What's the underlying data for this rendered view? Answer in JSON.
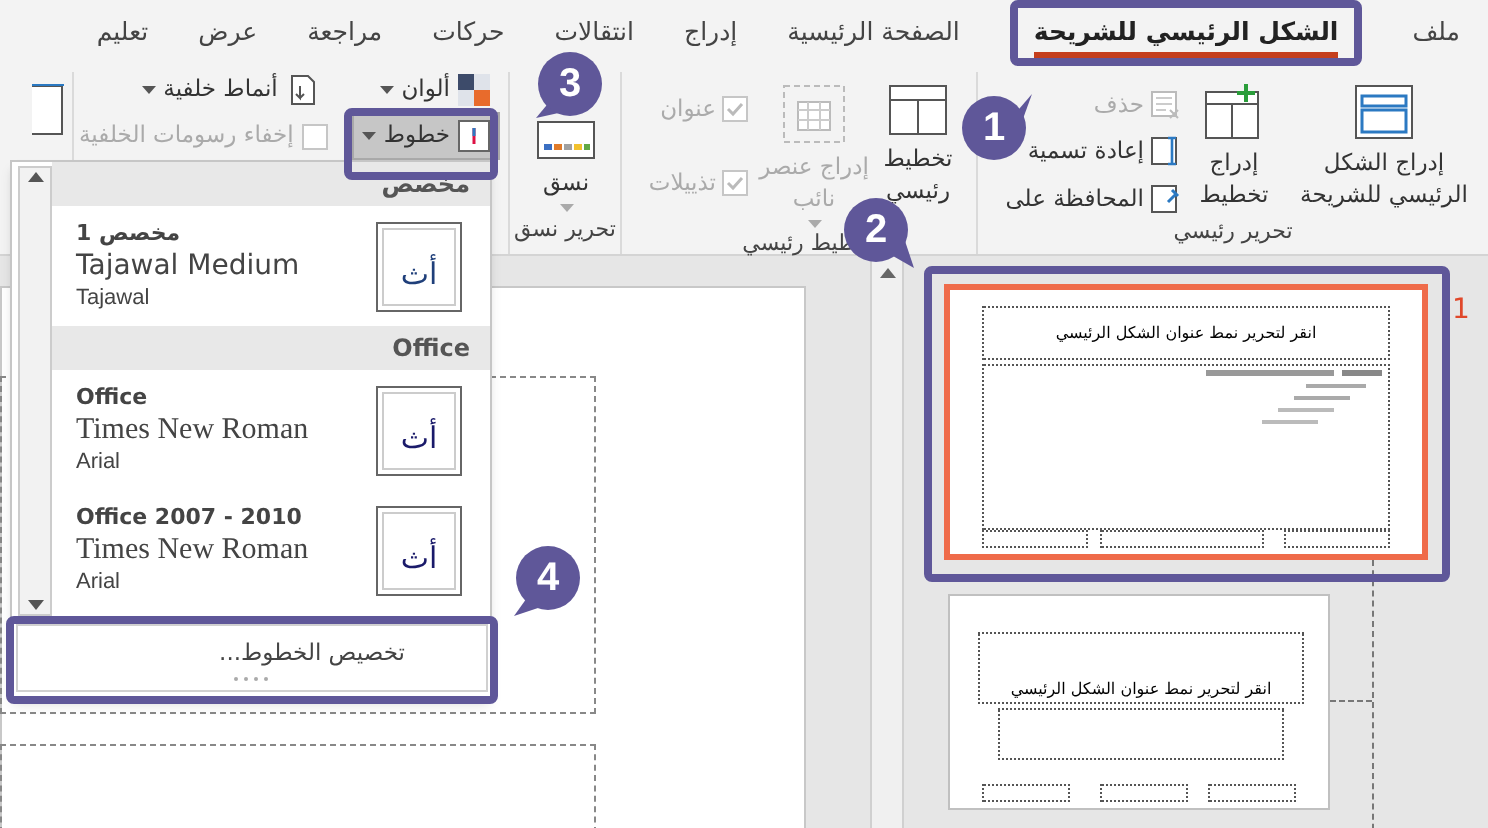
{
  "tabs": [
    {
      "label": "ملف",
      "selected": false
    },
    {
      "label": "الشكل الرئيسي للشريحة",
      "selected": true
    },
    {
      "label": "الصفحة الرئيسية",
      "selected": false
    },
    {
      "label": "إدراج",
      "selected": false
    },
    {
      "label": "انتقالات",
      "selected": false
    },
    {
      "label": "حركات",
      "selected": false
    },
    {
      "label": "مراجعة",
      "selected": false
    },
    {
      "label": "عرض",
      "selected": false
    },
    {
      "label": "تعليم",
      "selected": false
    }
  ],
  "master_edit": {
    "label": "تحرير رئيسي",
    "insert_master": "إدراج الشكل الرئيسي للشريحة",
    "insert_layout": "إدراج تخطيط",
    "small_buttons": [
      {
        "label": "حذف",
        "disabled": true
      },
      {
        "label": "إعادة تسمية",
        "disabled": false
      },
      {
        "label": "المحافظة على",
        "disabled": false
      }
    ]
  },
  "master_layout": {
    "label": "طيط رئيسي",
    "layout_button": "تخطيط رئيسي",
    "insert_placeholder": {
      "label": "إدراج عنصر نائب",
      "disabled": true
    },
    "checkboxes": [
      {
        "label": "عنوان",
        "checked": true,
        "disabled": true
      },
      {
        "label": "تذييلات",
        "checked": true,
        "disabled": true
      }
    ]
  },
  "edit_theme": {
    "label": "تحرير نسق",
    "themes_button": "نسق"
  },
  "background": {
    "buttons": [
      {
        "label": "ألوان",
        "pressed": false
      },
      {
        "label": "خطوط",
        "pressed": true
      },
      {
        "label": "أنماط خلفية",
        "pressed": false
      }
    ],
    "hide_graphics": {
      "label": "إخفاء رسومات الخلفية",
      "checked": false,
      "disabled": true
    }
  },
  "fonts_dropdown": {
    "sections": [
      {
        "heading": "مخصص",
        "items": [
          {
            "name": "مخصص 1",
            "heading_font": "Tajawal Medium",
            "body_font": "Tajawal",
            "preview": "أث"
          }
        ]
      },
      {
        "heading": "Office",
        "items": [
          {
            "name": "Office",
            "heading_font": "Times New Roman",
            "body_font": "Arial",
            "preview": "أث"
          },
          {
            "name": "Office 2007 - 2010",
            "heading_font": "Times New Roman",
            "body_font": "Arial",
            "preview": "أث"
          }
        ]
      }
    ],
    "footer": "تخصيص الخطوط..."
  },
  "thumbnails": [
    {
      "number": "1",
      "title": "انقر لتحرير نمط عنوان الشكل الرئيسي",
      "selected": true
    },
    {
      "title": "انقر لتحرير نمط عنوان الشكل الرئيسي",
      "selected": false
    }
  ],
  "callouts": [
    {
      "number": "1"
    },
    {
      "number": "2"
    },
    {
      "number": "3"
    },
    {
      "number": "4"
    }
  ]
}
